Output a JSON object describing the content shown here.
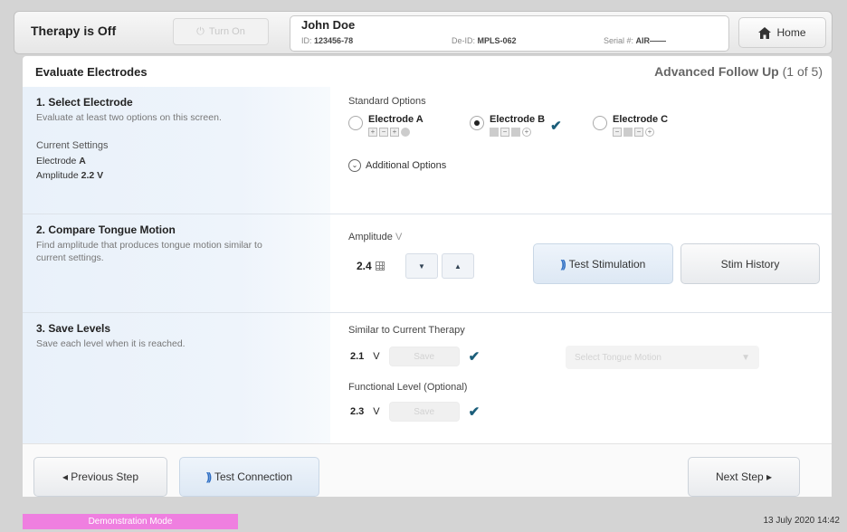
{
  "topbar": {
    "therapy_status": "Therapy is Off",
    "turn_on_label": "Turn On",
    "patient_name": "John Doe",
    "patient_id_label": "ID:",
    "patient_id": "123456-78",
    "device_id_label": "De-ID:",
    "device_id": "MPLS-062",
    "serial_label": "Serial #:",
    "serial": "AIR——",
    "home_label": "Home",
    "home_icon": "home-icon"
  },
  "header": {
    "title": "Evaluate Electrodes",
    "step_name": "Advanced Follow Up",
    "step_count": "(1 of 5)"
  },
  "section1": {
    "title": "1. Select Electrode",
    "desc": "Evaluate at least two options on this screen.",
    "current_label": "Current Settings",
    "electrode_prefix": "Electrode",
    "electrode_value": "A",
    "amplitude_prefix": "Amplitude",
    "amplitude_value": "2.2 V",
    "options_label": "Standard Options",
    "electrodes": [
      {
        "name": "Electrode A",
        "selected": false,
        "evaluated": false
      },
      {
        "name": "Electrode B",
        "selected": true,
        "evaluated": true
      },
      {
        "name": "Electrode C",
        "selected": false,
        "evaluated": false
      }
    ],
    "additional_label": "Additional Options"
  },
  "section2": {
    "title": "2. Compare Tongue Motion",
    "desc": "Find amplitude that produces tongue motion similar to current settings.",
    "amp_label": "Amplitude",
    "amp_unit": "V",
    "amp_value": "2.4",
    "down_symbol": "▼",
    "up_symbol": "▲",
    "test_stim_label": "Test Stimulation",
    "stim_history_label": "Stim History"
  },
  "section3": {
    "title": "3. Save Levels",
    "desc": "Save each level when it is reached.",
    "similar_label": "Similar to Current Therapy",
    "similar_value": "2.1",
    "functional_label": "Functional Level (Optional)",
    "functional_value": "2.3",
    "unit": "V",
    "save_label": "Save",
    "select_motion_label": "Select Tongue Motion"
  },
  "footer": {
    "prev_label": "◂ Previous Step",
    "test_conn_label": "Test Connection",
    "next_label": "Next Step ▸"
  },
  "status": {
    "demo_label": "Demonstration Mode",
    "datetime": "13 July 2020 14:42",
    "demo_color": "#ef7fe0",
    "accent_check": "#1b5e7a",
    "stim_wave_color": "#2f6fc4"
  }
}
